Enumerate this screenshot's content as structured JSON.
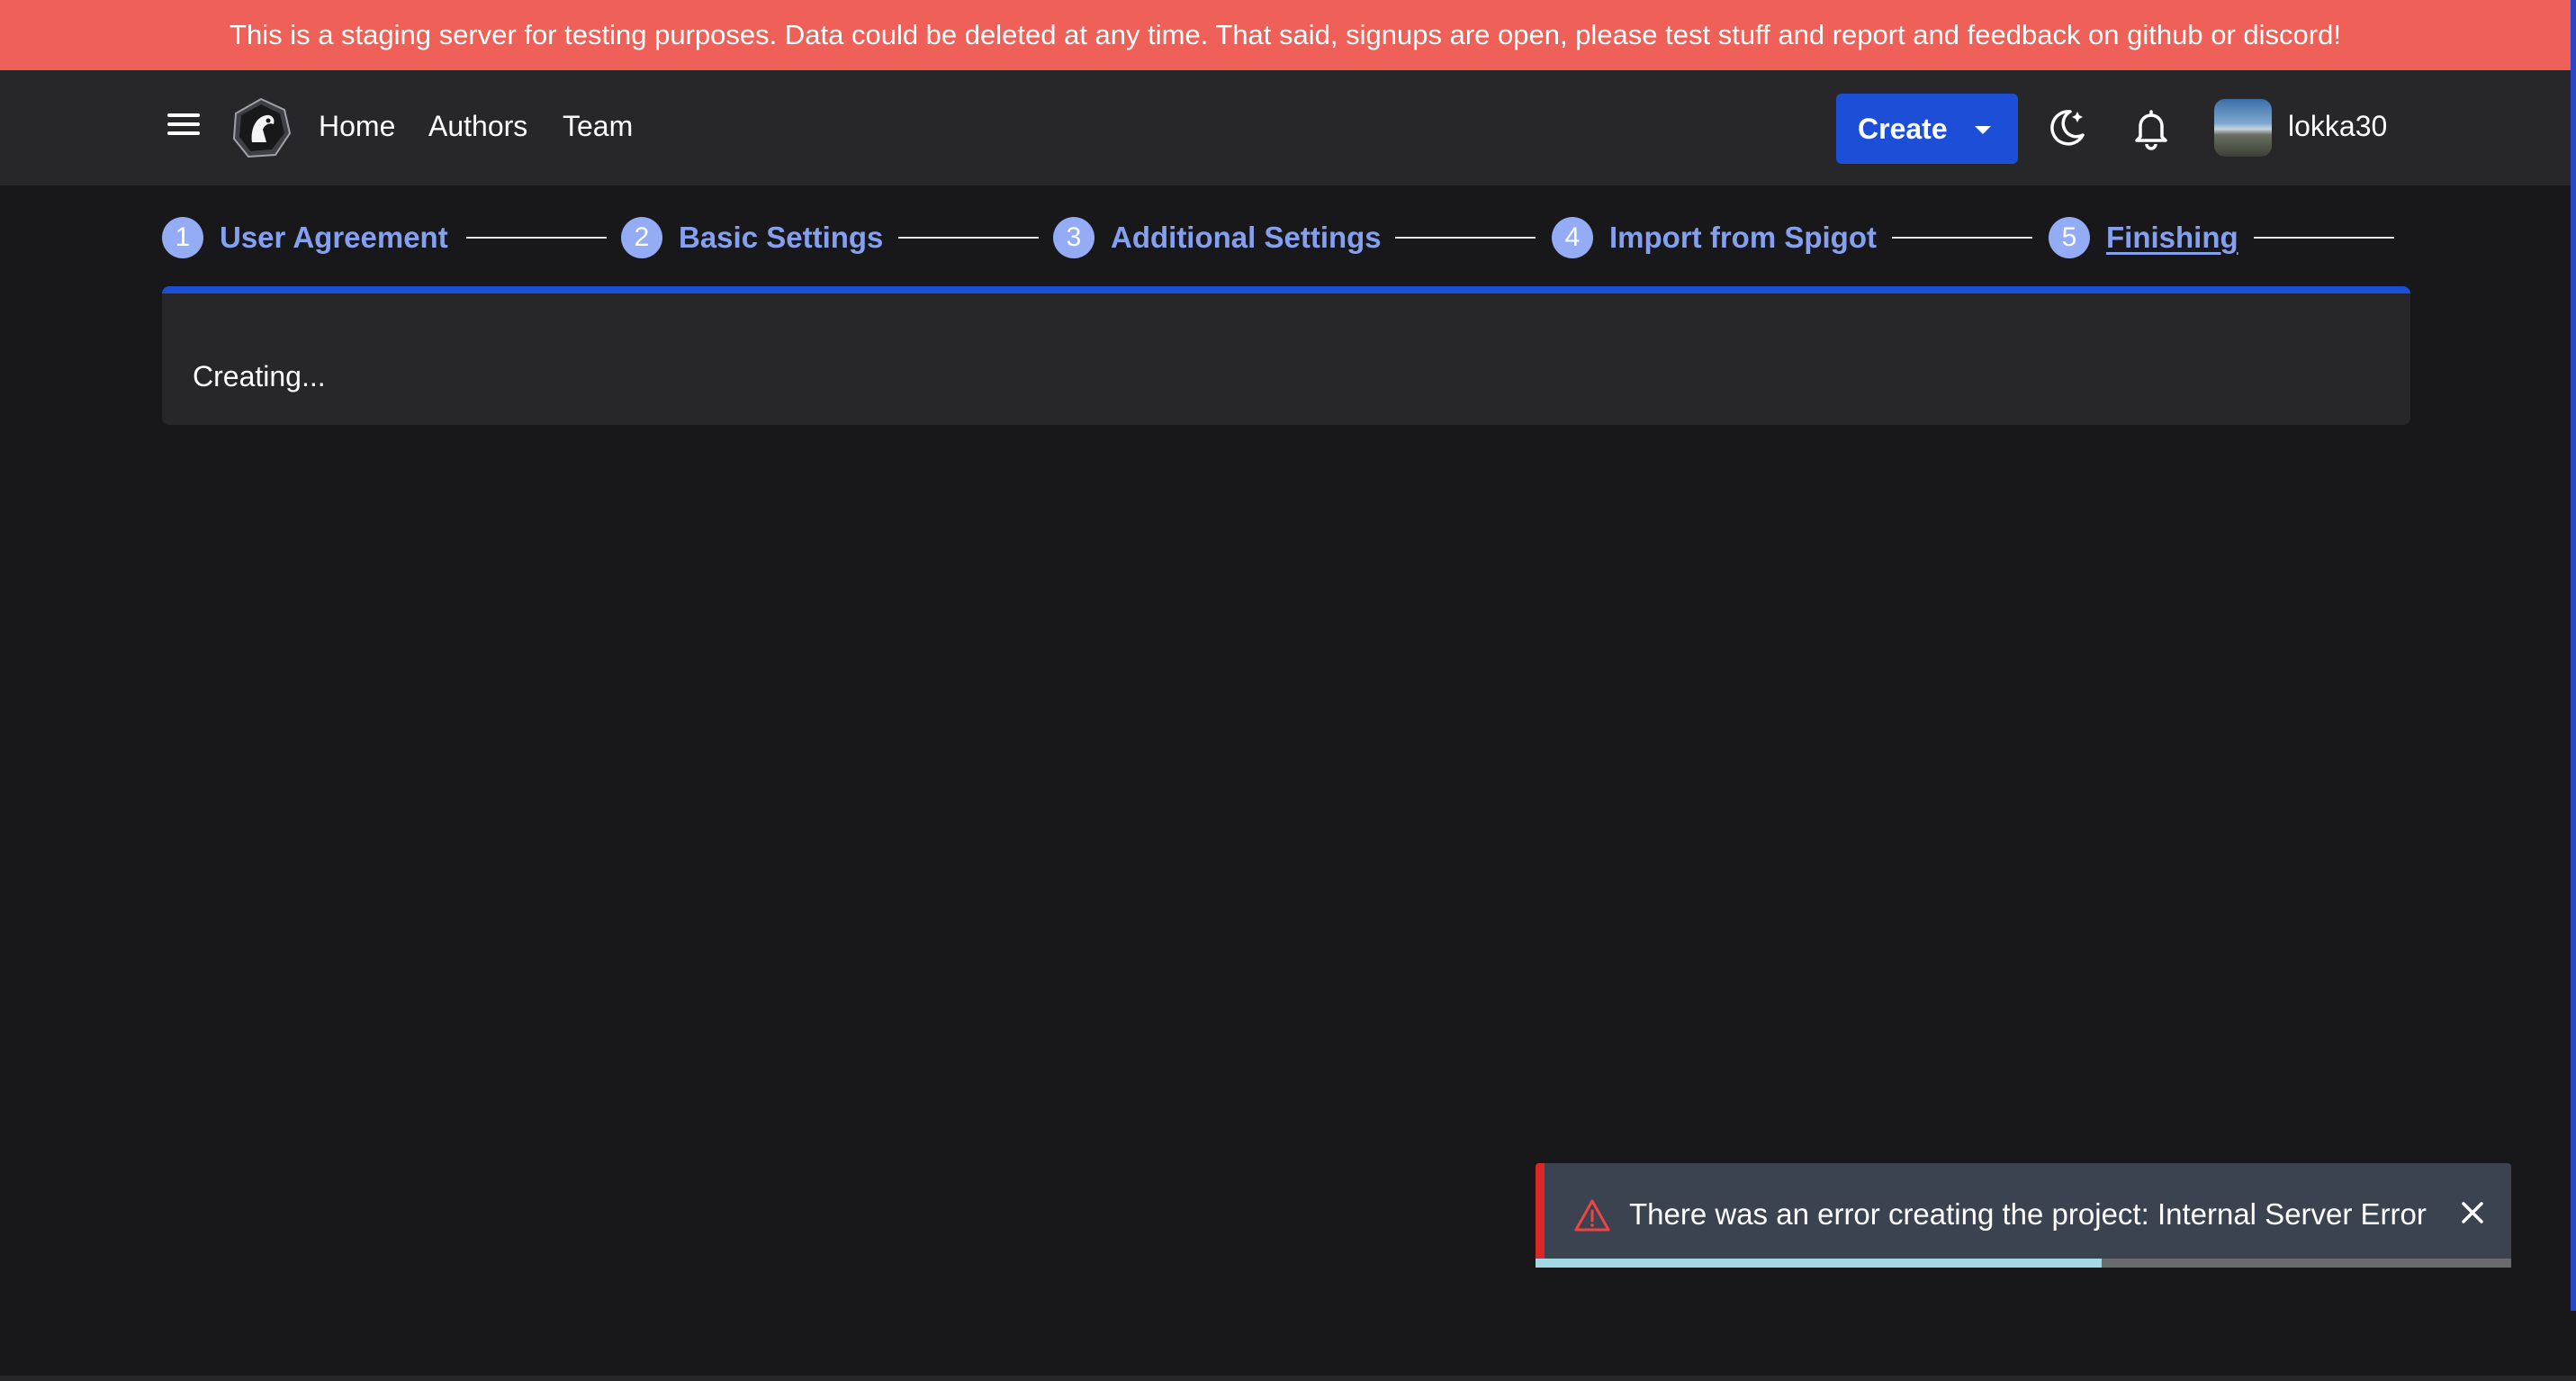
{
  "banner": {
    "text": "This is a staging server for testing purposes. Data could be deleted at any time. That said, signups are open, please test stuff and report and feedback on github or discord!"
  },
  "header": {
    "nav": [
      {
        "label": "Home"
      },
      {
        "label": "Authors"
      },
      {
        "label": "Team"
      }
    ],
    "create_label": "Create",
    "username": "lokka30"
  },
  "stepper": {
    "steps": [
      {
        "number": "1",
        "label": "User Agreement"
      },
      {
        "number": "2",
        "label": "Basic Settings"
      },
      {
        "number": "3",
        "label": "Additional Settings"
      },
      {
        "number": "4",
        "label": "Import from Spigot"
      },
      {
        "number": "5",
        "label": "Finishing"
      }
    ],
    "active_step": 5
  },
  "card": {
    "status_text": "Creating..."
  },
  "toast": {
    "message": "There was an error creating the project: Internal Server Error",
    "progress_fraction": 0.58
  },
  "colors": {
    "banner": "#ef6158",
    "accent": "#1d4ed8",
    "step_label": "#86a0f0",
    "error": "#dc2626"
  }
}
